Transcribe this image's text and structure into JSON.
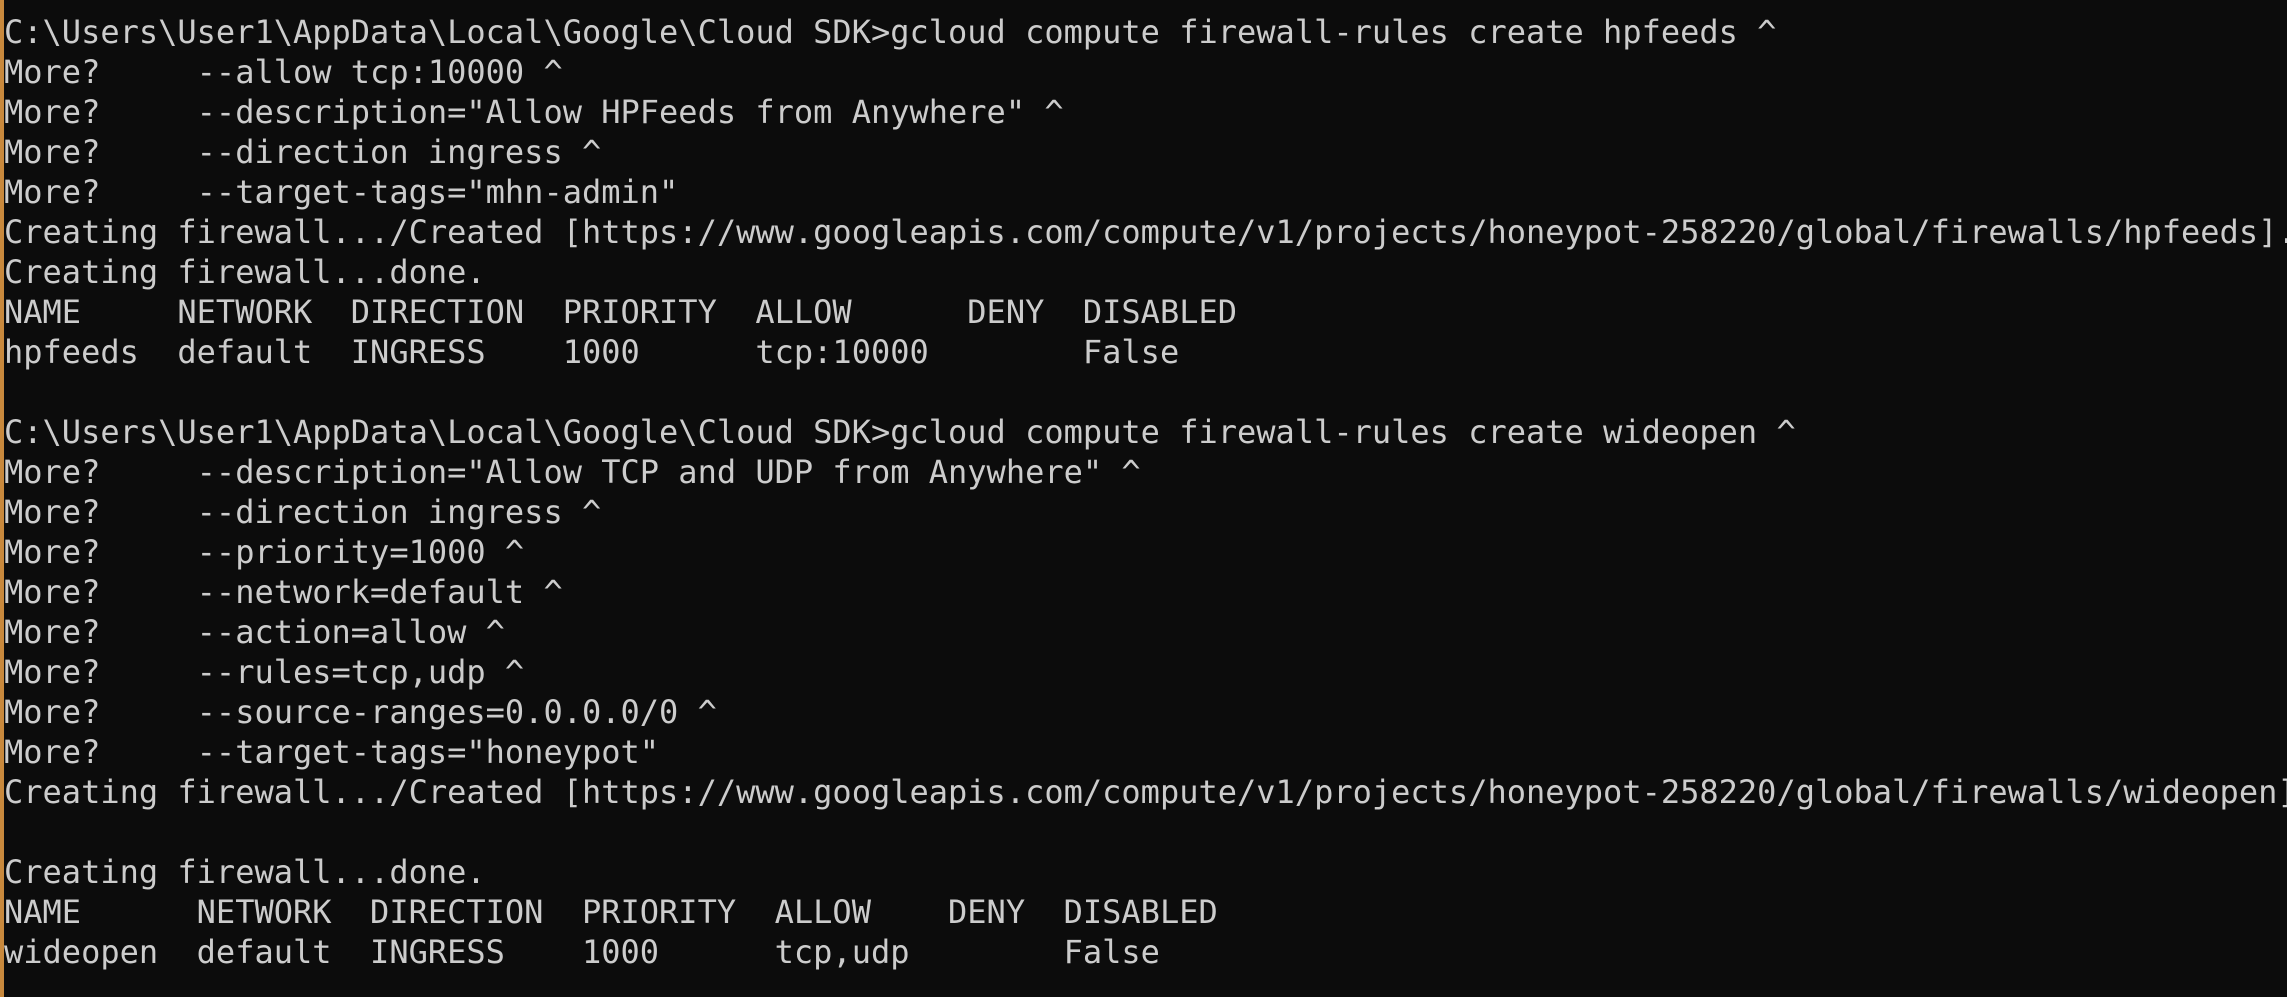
{
  "terminal": {
    "lines": [
      "C:\\Users\\User1\\AppData\\Local\\Google\\Cloud SDK>gcloud compute firewall-rules create hpfeeds ^",
      "More?     --allow tcp:10000 ^",
      "More?     --description=\"Allow HPFeeds from Anywhere\" ^",
      "More?     --direction ingress ^",
      "More?     --target-tags=\"mhn-admin\"",
      "Creating firewall.../Created [https://www.googleapis.com/compute/v1/projects/honeypot-258220/global/firewalls/hpfeeds].",
      "Creating firewall...done.",
      "NAME     NETWORK  DIRECTION  PRIORITY  ALLOW      DENY  DISABLED",
      "hpfeeds  default  INGRESS    1000      tcp:10000        False",
      "",
      "C:\\Users\\User1\\AppData\\Local\\Google\\Cloud SDK>gcloud compute firewall-rules create wideopen ^",
      "More?     --description=\"Allow TCP and UDP from Anywhere\" ^",
      "More?     --direction ingress ^",
      "More?     --priority=1000 ^",
      "More?     --network=default ^",
      "More?     --action=allow ^",
      "More?     --rules=tcp,udp ^",
      "More?     --source-ranges=0.0.0.0/0 ^",
      "More?     --target-tags=\"honeypot\"",
      "Creating firewall.../Created [https://www.googleapis.com/compute/v1/projects/honeypot-258220/global/firewalls/wideopen].",
      "",
      "Creating firewall...done.",
      "NAME      NETWORK  DIRECTION  PRIORITY  ALLOW    DENY  DISABLED",
      "wideopen  default  INGRESS    1000      tcp,udp        False"
    ]
  },
  "colors": {
    "background": "#0c0c0c",
    "foreground": "#cccccc",
    "accent_border": "#c8893d"
  }
}
